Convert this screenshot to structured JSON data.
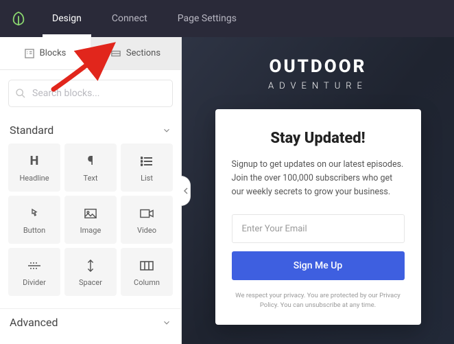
{
  "topnav": {
    "items": [
      "Design",
      "Connect",
      "Page Settings"
    ],
    "active": 0
  },
  "sidepanel": {
    "tabs": {
      "blocks": "Blocks",
      "sections": "Sections",
      "active": "blocks"
    },
    "search_placeholder": "Search blocks...",
    "groups": {
      "standard": {
        "title": "Standard",
        "blocks": [
          {
            "id": "headline",
            "label": "Headline"
          },
          {
            "id": "text",
            "label": "Text"
          },
          {
            "id": "list",
            "label": "List"
          },
          {
            "id": "button",
            "label": "Button"
          },
          {
            "id": "image",
            "label": "Image"
          },
          {
            "id": "video",
            "label": "Video"
          },
          {
            "id": "divider",
            "label": "Divider"
          },
          {
            "id": "spacer",
            "label": "Spacer"
          },
          {
            "id": "column",
            "label": "Column"
          }
        ]
      },
      "advanced": {
        "title": "Advanced"
      }
    }
  },
  "preview": {
    "brand_main": "OUTDOOR",
    "brand_sub": "ADVENTURE",
    "card": {
      "heading": "Stay Updated!",
      "body": "Signup to get updates on our latest episodes. Join the over 100,000 subscribers who get our weekly secrets to grow your business.",
      "email_placeholder": "Enter Your Email",
      "cta": "Sign Me Up",
      "disclaimer": "We respect your privacy. You are protected by our Privacy Policy. You can unsubscribe at any time."
    }
  }
}
